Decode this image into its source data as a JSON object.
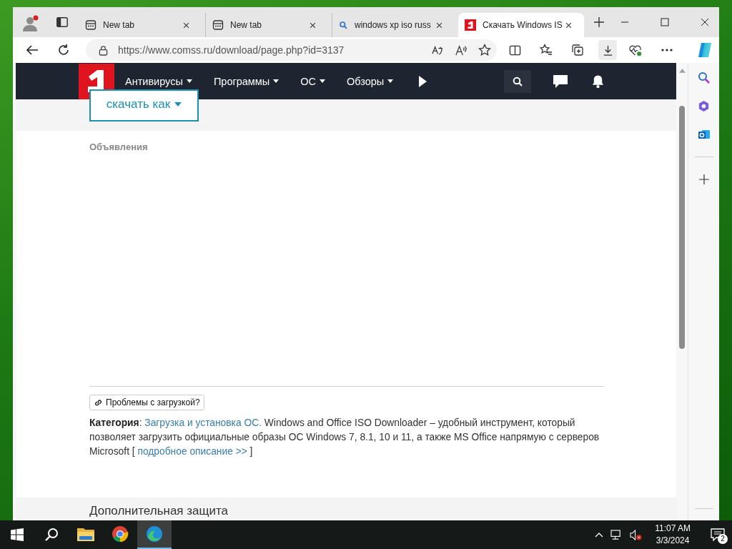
{
  "tabs": [
    {
      "kind": "newtab",
      "title": "New tab",
      "selected": false
    },
    {
      "kind": "newtab",
      "title": "New tab",
      "selected": false
    },
    {
      "kind": "search",
      "title": "windows xp iso russ",
      "selected": false
    },
    {
      "kind": "site",
      "title": "Скачать Windows IS",
      "selected": true
    }
  ],
  "address_bar": {
    "url": "https://www.comss.ru/download/page.php?id=3137"
  },
  "site_nav": {
    "items": [
      "Антивирусы",
      "Программы",
      "ОС",
      "Обзоры"
    ]
  },
  "download_button": "скачать как",
  "ads_label": "Объявления",
  "problems_button": "Проблемы с загрузкой?",
  "description": [
    {
      "kind": "bold",
      "text": "Категория"
    },
    {
      "kind": "text",
      "text": ": "
    },
    {
      "kind": "link",
      "text": "Загрузка и установка ОС."
    },
    {
      "kind": "text",
      "text": " Windows and Office ISO Downloader – удобный инструмент, который позволяет загрузить официальные образы ОС Windows 7, 8.1, 10 и 11, а также MS Office напрямую с серверов Microsoft [ "
    },
    {
      "kind": "link",
      "text": "подробное описание >>"
    },
    {
      "kind": "text",
      "text": " ]"
    }
  ],
  "next_section_title": "Дополнительная защита",
  "taskbar": {
    "time": "11:07 AM",
    "date": "3/3/2024",
    "notification_count": "2"
  }
}
